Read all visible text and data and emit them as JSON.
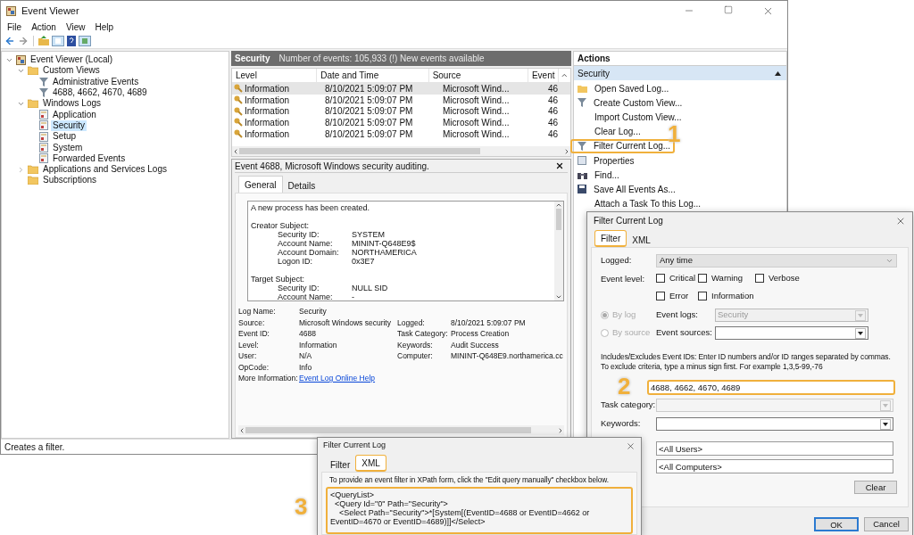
{
  "main_window": {
    "title": "Event Viewer",
    "menu": [
      "File",
      "Action",
      "View",
      "Help"
    ],
    "tree": [
      {
        "label": "Event Viewer (Local)",
        "selected": false,
        "expanded": true,
        "children": [
          {
            "label": "Custom Views",
            "selected": false,
            "expanded": true,
            "children": [
              {
                "label": "Administrative Events",
                "selected": false
              },
              {
                "label": "4688, 4662, 4670, 4689",
                "selected": false
              }
            ]
          },
          {
            "label": "Windows Logs",
            "selected": false,
            "expanded": true,
            "children": [
              {
                "label": "Application",
                "selected": false
              },
              {
                "label": "Security",
                "selected": true
              },
              {
                "label": "Setup",
                "selected": false
              },
              {
                "label": "System",
                "selected": false
              },
              {
                "label": "Forwarded Events",
                "selected": false
              }
            ]
          },
          {
            "label": "Applications and Services Logs",
            "selected": false,
            "expanded": false
          },
          {
            "label": "Subscriptions",
            "selected": false
          }
        ]
      }
    ],
    "log_header": {
      "title": "Security",
      "summary": "Number of events: 105,933 (!) New events available"
    },
    "events_table": {
      "columns": [
        "Level",
        "Date and Time",
        "Source",
        "Event"
      ],
      "rows": [
        {
          "level": "Information",
          "date": "8/10/2021 5:09:07 PM",
          "source": "Microsoft Wind...",
          "event": "46",
          "selected": true
        },
        {
          "level": "Information",
          "date": "8/10/2021 5:09:07 PM",
          "source": "Microsoft Wind...",
          "event": "46",
          "selected": false
        },
        {
          "level": "Information",
          "date": "8/10/2021 5:09:07 PM",
          "source": "Microsoft Wind...",
          "event": "46",
          "selected": false
        },
        {
          "level": "Information",
          "date": "8/10/2021 5:09:07 PM",
          "source": "Microsoft Wind...",
          "event": "46",
          "selected": false
        },
        {
          "level": "Information",
          "date": "8/10/2021 5:09:07 PM",
          "source": "Microsoft Wind...",
          "event": "46",
          "selected": false
        }
      ]
    },
    "event_detail": {
      "title": "Event 4688, Microsoft Windows security auditing.",
      "tabs": [
        {
          "label": "General",
          "selected": true
        },
        {
          "label": "Details",
          "selected": false
        }
      ],
      "description": [
        {
          "kind": "text",
          "text": "A new process has been created."
        },
        {
          "kind": "text",
          "text": "Creator Subject:"
        },
        {
          "kind": "field",
          "label": "Security ID:",
          "value": "SYSTEM"
        },
        {
          "kind": "field",
          "label": "Account Name:",
          "value": "MININT-Q648E9$"
        },
        {
          "kind": "field",
          "label": "Account Domain:",
          "value": "NORTHAMERICA"
        },
        {
          "kind": "field",
          "label": "Logon ID:",
          "value": "0x3E7"
        },
        {
          "kind": "text",
          "text": "Target Subject:"
        },
        {
          "kind": "field",
          "label": "Security ID:",
          "value": "NULL SID"
        },
        {
          "kind": "field",
          "label": "Account Name:",
          "value": "-"
        }
      ],
      "fields": [
        {
          "label": "Log Name:",
          "value": "Security"
        },
        {
          "label": "Source:",
          "value": "Microsoft Windows security",
          "label2": "Logged:",
          "value2": "8/10/2021 5:09:07 PM"
        },
        {
          "label": "Event ID:",
          "value": "4688",
          "label2": "Task Category:",
          "value2": "Process Creation"
        },
        {
          "label": "Level:",
          "value": "Information",
          "label2": "Keywords:",
          "value2": "Audit Success"
        },
        {
          "label": "User:",
          "value": "N/A",
          "label2": "Computer:",
          "value2": "MININT-Q648E9.northamerica.cc"
        },
        {
          "label": "OpCode:",
          "value": "Info"
        }
      ],
      "more_info": {
        "label": "More Information:",
        "link": "Event Log Online Help"
      }
    },
    "actions": {
      "title": "Actions",
      "section": "Security",
      "items": [
        {
          "label": "Open Saved Log...",
          "highlighted": false
        },
        {
          "label": "Create Custom View...",
          "highlighted": false
        },
        {
          "label": "Import Custom View...",
          "highlighted": false
        },
        {
          "label": "Clear Log...",
          "highlighted": false
        },
        {
          "label": "Filter Current Log...",
          "highlighted": true
        },
        {
          "label": "Properties",
          "highlighted": false
        },
        {
          "label": "Find...",
          "highlighted": false
        },
        {
          "label": "Save All Events As...",
          "highlighted": false
        },
        {
          "label": "Attach a Task To this Log...",
          "highlighted": false
        }
      ]
    },
    "status_bar": "Creates a filter."
  },
  "filter_dialog": {
    "title": "Filter Current Log",
    "tabs": [
      {
        "label": "Filter",
        "selected": true,
        "highlighted": true
      },
      {
        "label": "XML",
        "selected": false,
        "highlighted": false
      }
    ],
    "logged": {
      "label": "Logged:",
      "value": "Any time"
    },
    "event_level": {
      "label": "Event level:",
      "options": [
        {
          "label": "Critical",
          "checked": false
        },
        {
          "label": "Warning",
          "checked": false
        },
        {
          "label": "Verbose",
          "checked": false
        },
        {
          "label": "Error",
          "checked": false
        },
        {
          "label": "Information",
          "checked": false
        }
      ]
    },
    "sources": [
      {
        "radio": "By log",
        "selected": true,
        "label": "Event logs:",
        "value": "Security",
        "disabled": true
      },
      {
        "radio": "By source",
        "selected": false,
        "label": "Event sources:",
        "disabled": false
      }
    ],
    "ids_help": "Includes/Excludes Event IDs: Enter ID numbers and/or ID ranges separated by commas. To exclude criteria, type a minus sign first. For example 1,3,5-99,-76",
    "ids_value": "4688, 4662, 4670, 4689",
    "ids_highlighted": true,
    "task_category": {
      "label": "Task category:",
      "disabled": true
    },
    "keywords": {
      "label": "Keywords:",
      "disabled": false
    },
    "user_value": "<All Users>",
    "computer_value": "<All Computers>",
    "clear": "Clear",
    "ok": "OK",
    "cancel": "Cancel"
  },
  "xml_dialog": {
    "title": "Filter Current Log",
    "tabs": [
      {
        "label": "Filter",
        "selected": false,
        "highlighted": false
      },
      {
        "label": "XML",
        "selected": true,
        "highlighted": true
      }
    ],
    "hint": "To provide an event filter in XPath form, click the \"Edit query manually\" checkbox below.",
    "query": "<QueryList>\n  <Query Id=\"0\" Path=\"Security\">\n    <Select Path=\"Security\">*[System[(EventID=4688 or EventID=4662 or EventID=4670 or EventID=4689)]]</Select>",
    "query_highlighted": true
  },
  "annotations": [
    "1",
    "2",
    "3"
  ]
}
